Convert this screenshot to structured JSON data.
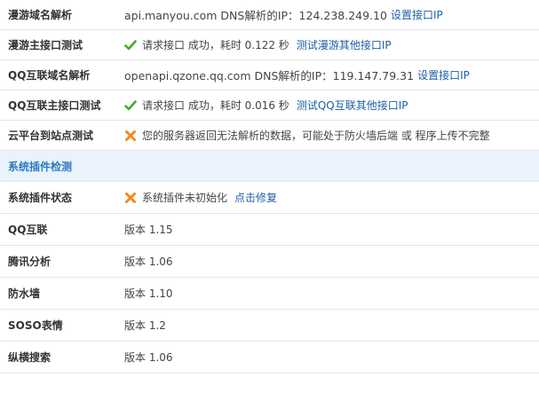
{
  "rows": [
    {
      "label": "漫游域名解析",
      "text": "api.manyou.com DNS解析的IP：124.238.249.10",
      "link": "设置接口IP"
    },
    {
      "label": "漫游主接口测试",
      "text1": "请求接口  成功，耗时  0.122 秒",
      "link": "测试漫游其他接口IP"
    },
    {
      "label": "QQ互联域名解析",
      "text": "openapi.qzone.qq.com DNS解析的IP：119.147.79.31",
      "link": "设置接口IP"
    },
    {
      "label": "QQ互联主接口测试",
      "text1": "请求接口  成功，耗时  0.016 秒",
      "link": "测试QQ互联其他接口IP"
    },
    {
      "label": "云平台到站点测试",
      "text1": "您的服务器返回无法解析的数据，可能处于防火墙后端  或  程序上传不完整"
    }
  ],
  "section": {
    "label": "系统插件检测"
  },
  "plugin_status": {
    "label": "系统插件状态",
    "text": "系统插件未初始化",
    "link": "点击修复"
  },
  "plugins": [
    {
      "label": "QQ互联",
      "version": "版本  1.15"
    },
    {
      "label": "腾讯分析",
      "version": "版本  1.06"
    },
    {
      "label": "防水墙",
      "version": "版本  1.10"
    },
    {
      "label": "SOSO表情",
      "version": "版本  1.2"
    },
    {
      "label": "纵横搜索",
      "version": "版本  1.06"
    }
  ],
  "colors": {
    "ok": "#3fae2a",
    "error": "#f08a1c",
    "link": "#1e5fa8",
    "section_bg": "#eaf2fb"
  }
}
